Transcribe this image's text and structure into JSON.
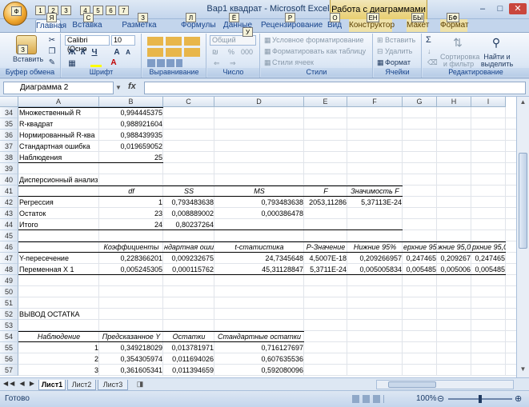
{
  "window": {
    "title": "Вар1 квадрат - Microsoft Excel",
    "context_title": "Работа с диаграммами"
  },
  "quick_access": [
    "1",
    "2",
    "3",
    "4",
    "5",
    "6",
    "7"
  ],
  "keytips": {
    "office": "Ф",
    "home": "Я",
    "insert": "С",
    "page_layout": "З",
    "formulas": "Л",
    "data": "Ё",
    "review": "Р",
    "view": "О",
    "developer": "ЕН",
    "layout": "БЫ",
    "format": "БФ",
    "paste": "З",
    "number_format": "У"
  },
  "tabs": [
    {
      "label": "Главная",
      "active": true
    },
    {
      "label": "Вставка"
    },
    {
      "label": "Разметка страницы"
    },
    {
      "label": "Формулы"
    },
    {
      "label": "Данные"
    },
    {
      "label": "Рецензирование"
    },
    {
      "label": "Вид"
    },
    {
      "label": "Конструктор",
      "ctx": true
    },
    {
      "label": "Макет",
      "ctx": true
    },
    {
      "label": "Формат",
      "ctx": true
    }
  ],
  "ribbon": {
    "clipboard": {
      "paste": "Вставить",
      "label": "Буфер обмена"
    },
    "font": {
      "name": "Calibri (Осно",
      "size": "10",
      "bold": "Ж",
      "italic": "К",
      "underline": "Ч",
      "grow": "A",
      "shrink": "A",
      "label": "Шрифт"
    },
    "alignment": {
      "label": "Выравнивание"
    },
    "number": {
      "format": "Общий",
      "percent": "%",
      "thousands": "000",
      "label": "Число"
    },
    "styles": {
      "conditional": "Условное форматирование",
      "as_table": "Форматировать как таблицу",
      "cell_styles": "Стили ячеек",
      "label": "Стили"
    },
    "cells": {
      "insert": "Вставить",
      "delete": "Удалить",
      "format": "Формат",
      "label": "Ячейки"
    },
    "editing": {
      "sum": "Σ",
      "sort": "Сортировка и фильтр",
      "find": "Найти и выделить",
      "label": "Редактирование"
    }
  },
  "formula_bar": {
    "name_box": "Диаграмма 2",
    "fx": "fx",
    "value": ""
  },
  "columns": [
    "A",
    "B",
    "C",
    "D",
    "E",
    "F",
    "G",
    "H",
    "I"
  ],
  "rows": [
    {
      "n": "34",
      "A": "Множественный R",
      "B": "0,994445375"
    },
    {
      "n": "35",
      "A": "R-квадрат",
      "B": "0,988921604"
    },
    {
      "n": "36",
      "A": "Нормированный R-ква",
      "B": "0,988439935"
    },
    {
      "n": "37",
      "A": "Стандартная ошибка",
      "B": "0,019659052"
    },
    {
      "n": "38",
      "A": "Наблюдения",
      "B": "25"
    },
    {
      "n": "39"
    },
    {
      "n": "40",
      "A": "Дисперсионный анализ"
    },
    {
      "n": "41",
      "B": "df",
      "C": "SS",
      "D": "MS",
      "E": "F",
      "F": "Значимость F"
    },
    {
      "n": "42",
      "A": "Регрессия",
      "B": "1",
      "C": "0,793483638",
      "D": "0,793483638",
      "E": "2053,11286",
      "F": "5,37113E-24"
    },
    {
      "n": "43",
      "A": "Остаток",
      "B": "23",
      "C": "0,008889002",
      "D": "0,000386478"
    },
    {
      "n": "44",
      "A": "Итого",
      "B": "24",
      "C": "0,80237264"
    },
    {
      "n": "45"
    },
    {
      "n": "46",
      "B": "Коэффициенты",
      "C": "ндартная оши",
      "D": "t-статистика",
      "E": "P-Значение",
      "F": "Нижние 95%",
      "G": "ерхние 95%",
      "H": "жние 95,0",
      "I": "рхние 95,0%"
    },
    {
      "n": "47",
      "A": "Y-пересечение",
      "B": "0,228366201",
      "C": "0,009232675",
      "D": "24,7345648",
      "E": "4,5007E-18",
      "F": "0,209266957",
      "G": "0,247465",
      "H": "0,209267",
      "I": "0,247465"
    },
    {
      "n": "48",
      "A": "Переменная X 1",
      "B": "0,005245305",
      "C": "0,000115762",
      "D": "45,31128847",
      "E": "5,3711E-24",
      "F": "0,005005834",
      "G": "0,005485",
      "H": "0,005006",
      "I": "0,005485"
    },
    {
      "n": "49"
    },
    {
      "n": "50"
    },
    {
      "n": "51"
    },
    {
      "n": "52",
      "A": "ВЫВОД ОСТАТКА"
    },
    {
      "n": "53"
    },
    {
      "n": "54",
      "A": "Наблюдение",
      "B": "Предсказанное Y",
      "C": "Остатки",
      "D": "Стандартные остатки"
    },
    {
      "n": "55",
      "A": "1",
      "B": "0,349218029",
      "C": "0,013781971",
      "D": "0,716127697"
    },
    {
      "n": "56",
      "A": "2",
      "B": "0,354305974",
      "C": "0,011694026",
      "D": "0,607635536"
    },
    {
      "n": "57",
      "A": "3",
      "B": "0,361605341",
      "C": "0,011394659",
      "D": "0,592080096"
    }
  ],
  "sheets": [
    {
      "label": "Лист1",
      "active": true
    },
    {
      "label": "Лист2"
    },
    {
      "label": "Лист3"
    }
  ],
  "status": {
    "text": "Готово",
    "zoom": "100%"
  }
}
